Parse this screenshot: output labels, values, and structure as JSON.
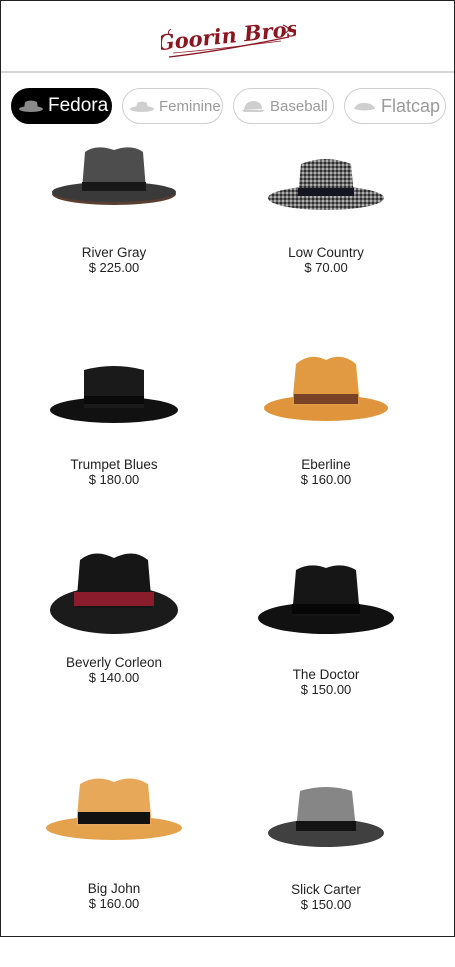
{
  "brand": {
    "logo_text": "Goorin Bros",
    "logo_color": "#8b1620"
  },
  "tabs": [
    {
      "label": "Fedora",
      "active": true,
      "icon": "fedora-icon"
    },
    {
      "label": "Feminine",
      "active": false,
      "icon": "feminine-hat-icon"
    },
    {
      "label": "Baseball",
      "active": false,
      "icon": "baseball-cap-icon"
    },
    {
      "label": "Flatcap",
      "active": false,
      "icon": "flatcap-icon"
    }
  ],
  "products": [
    {
      "name": "River Gray",
      "price": "$ 225.00",
      "image": "gray-fedora-hat"
    },
    {
      "name": "Low Country",
      "price": "$ 70.00",
      "image": "woven-pork-pie-hat"
    },
    {
      "name": "Trumpet Blues",
      "price": "$ 180.00",
      "image": "black-flat-brim-hat"
    },
    {
      "name": "Eberline",
      "price": "$ 160.00",
      "image": "straw-fedora-hat"
    },
    {
      "name": "Beverly Corleon",
      "price": "$ 140.00",
      "image": "black-fedora-red-band-hat"
    },
    {
      "name": "The Doctor",
      "price": "$ 150.00",
      "image": "black-fedora-hat"
    },
    {
      "name": "Big John",
      "price": "$ 160.00",
      "image": "straw-fedora-black-band-hat"
    },
    {
      "name": "Slick Carter",
      "price": "$ 150.00",
      "image": "gray-pork-pie-hat"
    }
  ]
}
